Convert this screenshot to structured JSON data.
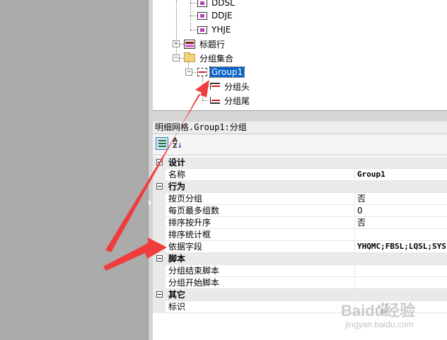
{
  "tree": {
    "items": [
      {
        "label": "DDSL"
      },
      {
        "label": "DDJE"
      },
      {
        "label": "YHJE"
      },
      {
        "label": "标题行"
      },
      {
        "label": "分组集合"
      },
      {
        "label": "Group1"
      },
      {
        "label": "分组头"
      },
      {
        "label": "分组尾"
      }
    ],
    "selected": "Group1"
  },
  "properties": {
    "title": "明细网格.Group1:分组",
    "categories": [
      {
        "label": "设计",
        "rows": [
          {
            "name": "名称",
            "value": "Group1"
          }
        ]
      },
      {
        "label": "行为",
        "rows": [
          {
            "name": "按页分组",
            "value": "否"
          },
          {
            "name": "每页最多组数",
            "value": "0"
          },
          {
            "name": "排序按升序",
            "value": "否"
          },
          {
            "name": "排序统计框",
            "value": ""
          },
          {
            "name": "依据字段",
            "value": "YHQMC;FBSL;LQSL;SYS"
          }
        ]
      },
      {
        "label": "脚本",
        "rows": [
          {
            "name": "分组结束脚本",
            "value": ""
          },
          {
            "name": "分组开始脚本",
            "value": ""
          }
        ]
      },
      {
        "label": "其它",
        "rows": [
          {
            "name": "标识",
            "value": ""
          }
        ]
      }
    ]
  },
  "watermark": {
    "brand": "Baidu经验",
    "site": "jingyan.baidu.com"
  },
  "colors": {
    "selection": "#0a64c8",
    "arrow": "#f03c3c",
    "leftPane": "#ababab"
  }
}
